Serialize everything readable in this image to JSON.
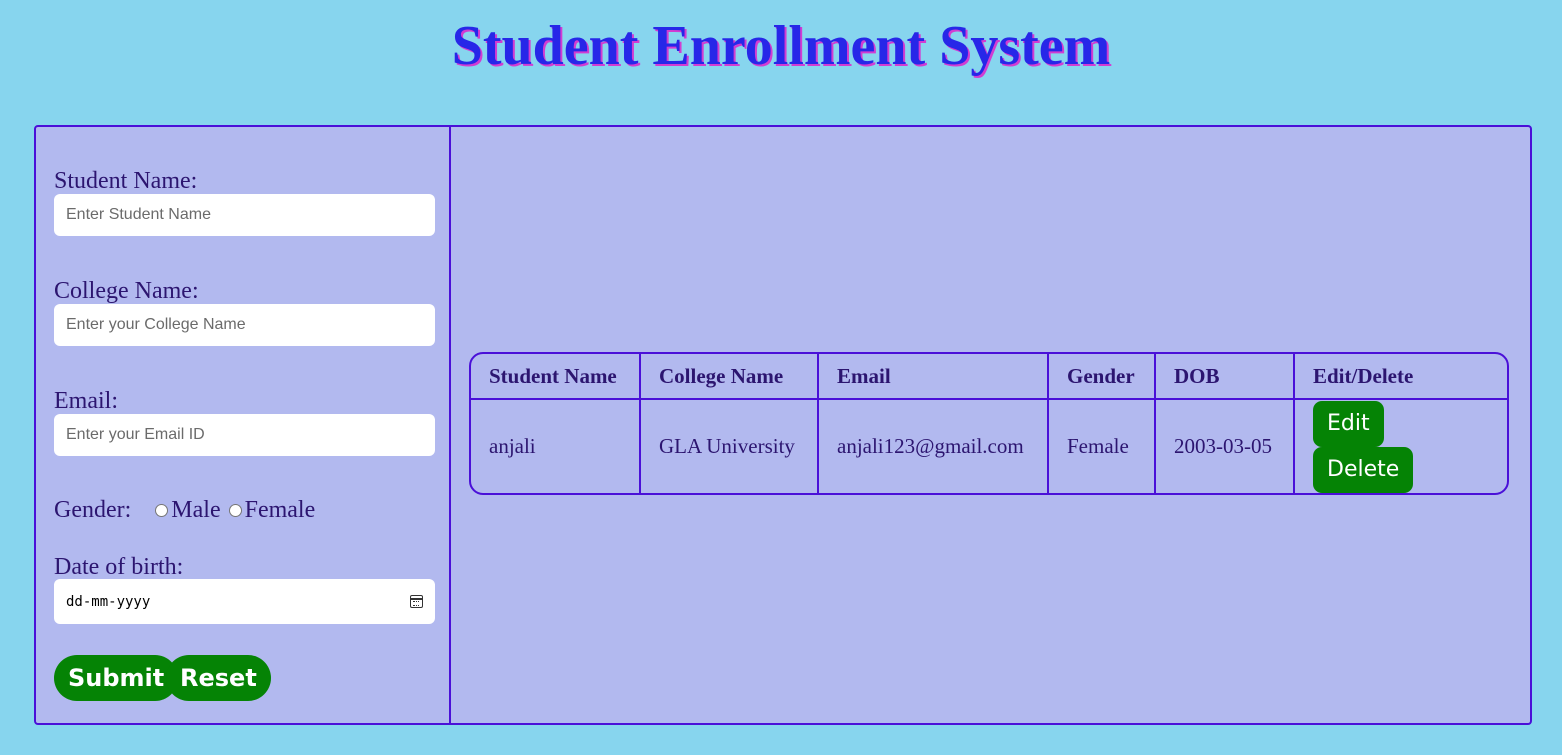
{
  "page": {
    "title": "Student Enrollment System"
  },
  "form": {
    "student_name_label": "Student Name:",
    "student_name_placeholder": "Enter Student Name",
    "college_name_label": "College Name:",
    "college_name_placeholder": "Enter your College Name",
    "email_label": "Email:",
    "email_placeholder": "Enter your Email ID",
    "gender_label": "Gender:",
    "gender_options": [
      "Male",
      "Female"
    ],
    "dob_label": "Date of birth:",
    "dob_placeholder": "dd-mm-yyyy",
    "submit_label": "Submit",
    "reset_label": "Reset"
  },
  "table": {
    "headers": [
      "Student Name",
      "College Name",
      "Email",
      "Gender",
      "DOB",
      "Edit/Delete"
    ],
    "rows": [
      {
        "name": "anjali",
        "college": "GLA University",
        "email": "anjali123@gmail.com",
        "gender": "Female",
        "dob": "2003-03-05",
        "edit_label": "Edit",
        "delete_label": "Delete"
      }
    ]
  },
  "colors": {
    "background": "#87d5ee",
    "panel": "#b2b9ef",
    "border": "#4a10d8",
    "button": "#058305",
    "title": "#2727e8"
  }
}
